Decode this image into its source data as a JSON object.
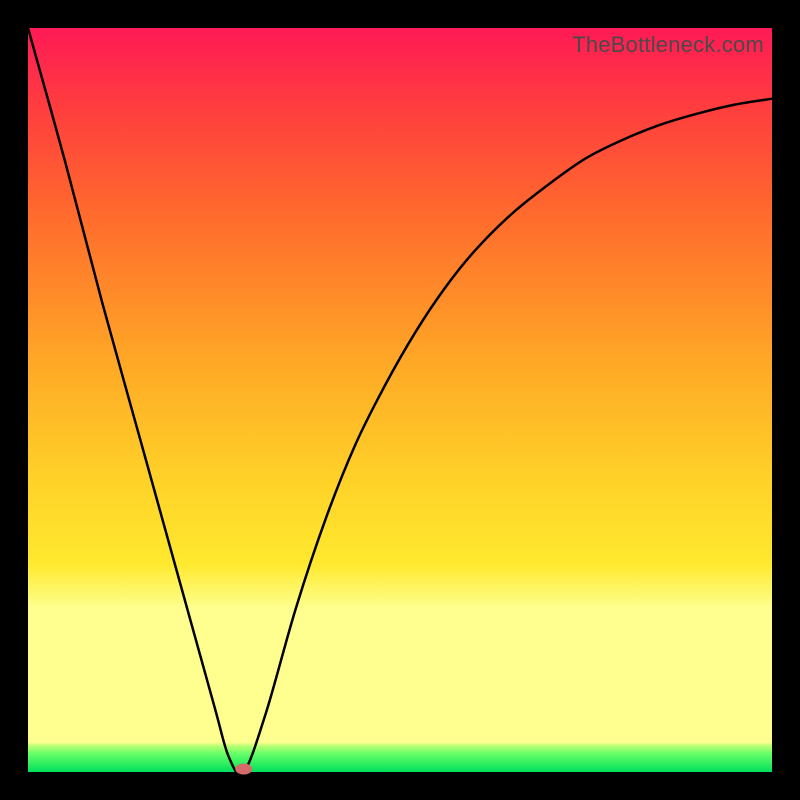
{
  "watermark": "TheBottleneck.com",
  "chart_data": {
    "type": "line",
    "title": "",
    "xlabel": "",
    "ylabel": "",
    "xlim": [
      0,
      100
    ],
    "ylim": [
      0,
      100
    ],
    "grid": false,
    "legend": false,
    "series": [
      {
        "name": "bottleneck-curve",
        "x": [
          0,
          5,
          10,
          15,
          20,
          25,
          27,
          29,
          32,
          36,
          40,
          44,
          48,
          52,
          56,
          60,
          65,
          70,
          75,
          80,
          85,
          90,
          95,
          100
        ],
        "values": [
          100,
          82,
          63,
          45,
          27,
          9,
          2,
          0,
          8,
          22,
          34,
          44,
          52,
          59,
          65,
          70,
          75,
          79,
          82.5,
          85,
          87,
          88.5,
          89.7,
          90.5
        ]
      }
    ],
    "annotations": [
      {
        "name": "minimum-point",
        "x": 29,
        "y": 0
      }
    ],
    "background_gradient": {
      "direction": "top-to-bottom",
      "stops": [
        {
          "pos": 0.0,
          "color": "#ff1a56"
        },
        {
          "pos": 0.25,
          "color": "#ff6a2d"
        },
        {
          "pos": 0.6,
          "color": "#ffd028"
        },
        {
          "pos": 0.8,
          "color": "#feff8e"
        },
        {
          "pos": 0.97,
          "color": "#68ff68"
        },
        {
          "pos": 1.0,
          "color": "#00e05c"
        }
      ]
    }
  }
}
